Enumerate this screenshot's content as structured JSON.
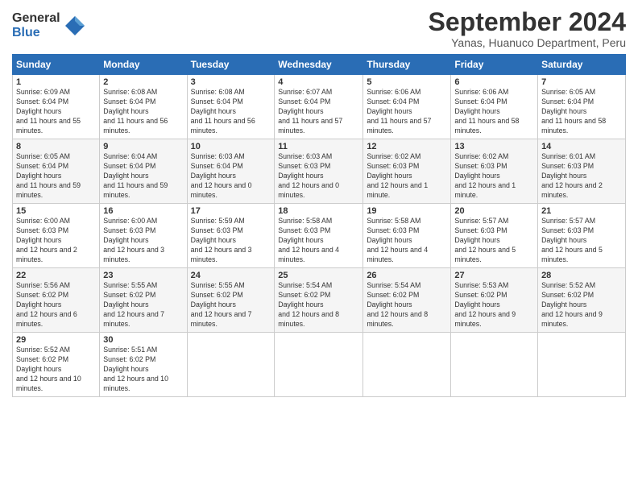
{
  "logo": {
    "general": "General",
    "blue": "Blue"
  },
  "title": "September 2024",
  "location": "Yanas, Huanuco Department, Peru",
  "days_of_week": [
    "Sunday",
    "Monday",
    "Tuesday",
    "Wednesday",
    "Thursday",
    "Friday",
    "Saturday"
  ],
  "weeks": [
    [
      {
        "day": "1",
        "sunrise": "6:09 AM",
        "sunset": "6:04 PM",
        "daylight": "11 hours and 55 minutes."
      },
      {
        "day": "2",
        "sunrise": "6:08 AM",
        "sunset": "6:04 PM",
        "daylight": "11 hours and 56 minutes."
      },
      {
        "day": "3",
        "sunrise": "6:08 AM",
        "sunset": "6:04 PM",
        "daylight": "11 hours and 56 minutes."
      },
      {
        "day": "4",
        "sunrise": "6:07 AM",
        "sunset": "6:04 PM",
        "daylight": "11 hours and 57 minutes."
      },
      {
        "day": "5",
        "sunrise": "6:06 AM",
        "sunset": "6:04 PM",
        "daylight": "11 hours and 57 minutes."
      },
      {
        "day": "6",
        "sunrise": "6:06 AM",
        "sunset": "6:04 PM",
        "daylight": "11 hours and 58 minutes."
      },
      {
        "day": "7",
        "sunrise": "6:05 AM",
        "sunset": "6:04 PM",
        "daylight": "11 hours and 58 minutes."
      }
    ],
    [
      {
        "day": "8",
        "sunrise": "6:05 AM",
        "sunset": "6:04 PM",
        "daylight": "11 hours and 59 minutes."
      },
      {
        "day": "9",
        "sunrise": "6:04 AM",
        "sunset": "6:04 PM",
        "daylight": "11 hours and 59 minutes."
      },
      {
        "day": "10",
        "sunrise": "6:03 AM",
        "sunset": "6:04 PM",
        "daylight": "12 hours and 0 minutes."
      },
      {
        "day": "11",
        "sunrise": "6:03 AM",
        "sunset": "6:03 PM",
        "daylight": "12 hours and 0 minutes."
      },
      {
        "day": "12",
        "sunrise": "6:02 AM",
        "sunset": "6:03 PM",
        "daylight": "12 hours and 1 minute."
      },
      {
        "day": "13",
        "sunrise": "6:02 AM",
        "sunset": "6:03 PM",
        "daylight": "12 hours and 1 minute."
      },
      {
        "day": "14",
        "sunrise": "6:01 AM",
        "sunset": "6:03 PM",
        "daylight": "12 hours and 2 minutes."
      }
    ],
    [
      {
        "day": "15",
        "sunrise": "6:00 AM",
        "sunset": "6:03 PM",
        "daylight": "12 hours and 2 minutes."
      },
      {
        "day": "16",
        "sunrise": "6:00 AM",
        "sunset": "6:03 PM",
        "daylight": "12 hours and 3 minutes."
      },
      {
        "day": "17",
        "sunrise": "5:59 AM",
        "sunset": "6:03 PM",
        "daylight": "12 hours and 3 minutes."
      },
      {
        "day": "18",
        "sunrise": "5:58 AM",
        "sunset": "6:03 PM",
        "daylight": "12 hours and 4 minutes."
      },
      {
        "day": "19",
        "sunrise": "5:58 AM",
        "sunset": "6:03 PM",
        "daylight": "12 hours and 4 minutes."
      },
      {
        "day": "20",
        "sunrise": "5:57 AM",
        "sunset": "6:03 PM",
        "daylight": "12 hours and 5 minutes."
      },
      {
        "day": "21",
        "sunrise": "5:57 AM",
        "sunset": "6:03 PM",
        "daylight": "12 hours and 5 minutes."
      }
    ],
    [
      {
        "day": "22",
        "sunrise": "5:56 AM",
        "sunset": "6:02 PM",
        "daylight": "12 hours and 6 minutes."
      },
      {
        "day": "23",
        "sunrise": "5:55 AM",
        "sunset": "6:02 PM",
        "daylight": "12 hours and 7 minutes."
      },
      {
        "day": "24",
        "sunrise": "5:55 AM",
        "sunset": "6:02 PM",
        "daylight": "12 hours and 7 minutes."
      },
      {
        "day": "25",
        "sunrise": "5:54 AM",
        "sunset": "6:02 PM",
        "daylight": "12 hours and 8 minutes."
      },
      {
        "day": "26",
        "sunrise": "5:54 AM",
        "sunset": "6:02 PM",
        "daylight": "12 hours and 8 minutes."
      },
      {
        "day": "27",
        "sunrise": "5:53 AM",
        "sunset": "6:02 PM",
        "daylight": "12 hours and 9 minutes."
      },
      {
        "day": "28",
        "sunrise": "5:52 AM",
        "sunset": "6:02 PM",
        "daylight": "12 hours and 9 minutes."
      }
    ],
    [
      {
        "day": "29",
        "sunrise": "5:52 AM",
        "sunset": "6:02 PM",
        "daylight": "12 hours and 10 minutes."
      },
      {
        "day": "30",
        "sunrise": "5:51 AM",
        "sunset": "6:02 PM",
        "daylight": "12 hours and 10 minutes."
      },
      null,
      null,
      null,
      null,
      null
    ]
  ]
}
